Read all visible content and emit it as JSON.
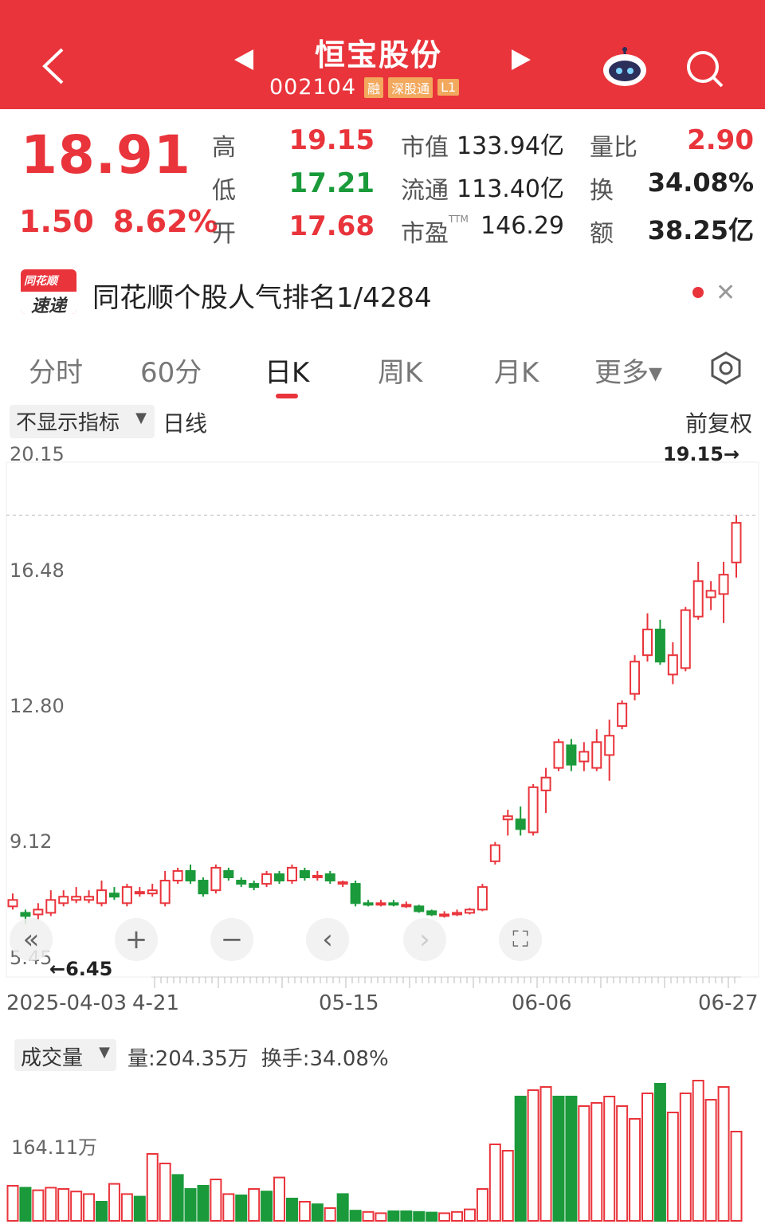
{
  "header": {
    "stock_name": "恒宝股份",
    "stock_code": "002104",
    "badges": [
      "融",
      "深股通",
      "L1"
    ],
    "back_icon": "chevron-left-icon",
    "prev_icon": "triangle-left-icon",
    "next_icon": "triangle-right-icon",
    "robot_icon": "robot-assistant-icon",
    "search_icon": "search-icon"
  },
  "quote": {
    "price": "18.91",
    "change": "1.50",
    "change_pct": "8.62%",
    "high_label": "高",
    "high": "19.15",
    "low_label": "低",
    "low": "17.21",
    "open_label": "开",
    "open": "17.68",
    "mktcap_label": "市值",
    "mktcap": "133.94亿",
    "float_label": "流通",
    "float": "113.40亿",
    "pe_label": "市盈",
    "pe_sup": "TTM",
    "pe": "146.29",
    "vratio_label": "量比",
    "vratio": "2.90",
    "turnover_label": "换",
    "turnover": "34.08%",
    "amount_label": "额",
    "amount": "38.25亿"
  },
  "ranking": {
    "logo_top": "同花顺",
    "logo_bottom": "速递",
    "text": "同花顺个股人气排名1/4284"
  },
  "tabs": [
    {
      "label": "分时"
    },
    {
      "label": "60分"
    },
    {
      "label": "日K"
    },
    {
      "label": "周K"
    },
    {
      "label": "月K"
    },
    {
      "label": "更多▾"
    }
  ],
  "indicator": {
    "select": "不显示指标",
    "period": "日线",
    "adjust": "前复权"
  },
  "chart_labels": {
    "low_mark": "←6.45",
    "high_mark": "19.15→",
    "y_ticks": [
      "20.15",
      "16.48",
      "12.80",
      "9.12",
      "5.45"
    ],
    "x_ticks": [
      "2025-04-03",
      "4-21",
      "05-15",
      "06-06",
      "06-27"
    ]
  },
  "toolbar": {
    "first": "«",
    "zoom_in": "+",
    "zoom_out": "−",
    "prev": "‹",
    "next": "›",
    "fullscreen": "⛶"
  },
  "volume": {
    "select": "成交量",
    "vol_text": "量:204.35万",
    "turnover_text": "换手:34.08%",
    "y_label": "164.11万"
  },
  "colors": {
    "up": "#e9343b",
    "down": "#1a9a3a",
    "header_bg": "#e9343b"
  },
  "chart_data": {
    "type": "candlestick",
    "ylim": [
      5.45,
      20.15
    ],
    "y_ticks": [
      20.15,
      16.48,
      12.8,
      9.12,
      5.45
    ],
    "candles": [
      {
        "o": 7.0,
        "c": 7.2,
        "h": 7.4,
        "l": 6.9
      },
      {
        "o": 6.8,
        "c": 6.7,
        "h": 6.9,
        "l": 6.45
      },
      {
        "o": 6.75,
        "c": 6.9,
        "h": 7.1,
        "l": 6.6
      },
      {
        "o": 6.8,
        "c": 7.2,
        "h": 7.5,
        "l": 6.7
      },
      {
        "o": 7.1,
        "c": 7.3,
        "h": 7.5,
        "l": 7.0
      },
      {
        "o": 7.2,
        "c": 7.3,
        "h": 7.6,
        "l": 7.1
      },
      {
        "o": 7.2,
        "c": 7.3,
        "h": 7.5,
        "l": 7.1
      },
      {
        "o": 7.1,
        "c": 7.5,
        "h": 7.8,
        "l": 7.0
      },
      {
        "o": 7.4,
        "c": 7.3,
        "h": 7.6,
        "l": 7.2
      },
      {
        "o": 7.1,
        "c": 7.6,
        "h": 7.7,
        "l": 7.0
      },
      {
        "o": 7.4,
        "c": 7.45,
        "h": 7.6,
        "l": 7.3
      },
      {
        "o": 7.4,
        "c": 7.5,
        "h": 7.7,
        "l": 7.3
      },
      {
        "o": 7.1,
        "c": 7.8,
        "h": 8.1,
        "l": 7.0
      },
      {
        "o": 7.8,
        "c": 8.1,
        "h": 8.2,
        "l": 7.7
      },
      {
        "o": 8.1,
        "c": 7.8,
        "h": 8.3,
        "l": 7.7
      },
      {
        "o": 7.8,
        "c": 7.4,
        "h": 7.9,
        "l": 7.3
      },
      {
        "o": 7.5,
        "c": 8.2,
        "h": 8.3,
        "l": 7.4
      },
      {
        "o": 8.1,
        "c": 7.9,
        "h": 8.2,
        "l": 7.8
      },
      {
        "o": 7.8,
        "c": 7.7,
        "h": 7.9,
        "l": 7.6
      },
      {
        "o": 7.7,
        "c": 7.6,
        "h": 7.8,
        "l": 7.5
      },
      {
        "o": 7.7,
        "c": 8.0,
        "h": 8.1,
        "l": 7.6
      },
      {
        "o": 8.0,
        "c": 7.8,
        "h": 8.1,
        "l": 7.7
      },
      {
        "o": 7.8,
        "c": 8.2,
        "h": 8.3,
        "l": 7.7
      },
      {
        "o": 8.1,
        "c": 7.9,
        "h": 8.2,
        "l": 7.8
      },
      {
        "o": 7.9,
        "c": 7.95,
        "h": 8.1,
        "l": 7.8
      },
      {
        "o": 8.0,
        "c": 7.8,
        "h": 8.1,
        "l": 7.7
      },
      {
        "o": 7.7,
        "c": 7.75,
        "h": 7.8,
        "l": 7.6
      },
      {
        "o": 7.7,
        "c": 7.1,
        "h": 7.8,
        "l": 7.0
      },
      {
        "o": 7.1,
        "c": 7.05,
        "h": 7.2,
        "l": 7.0
      },
      {
        "o": 7.05,
        "c": 7.1,
        "h": 7.2,
        "l": 7.0
      },
      {
        "o": 7.1,
        "c": 7.05,
        "h": 7.2,
        "l": 7.0
      },
      {
        "o": 7.0,
        "c": 7.05,
        "h": 7.15,
        "l": 6.95
      },
      {
        "o": 7.0,
        "c": 6.85,
        "h": 7.05,
        "l": 6.8
      },
      {
        "o": 6.85,
        "c": 6.75,
        "h": 6.9,
        "l": 6.7
      },
      {
        "o": 6.7,
        "c": 6.75,
        "h": 6.85,
        "l": 6.65
      },
      {
        "o": 6.75,
        "c": 6.8,
        "h": 6.9,
        "l": 6.7
      },
      {
        "o": 6.8,
        "c": 6.9,
        "h": 6.95,
        "l": 6.75
      },
      {
        "o": 6.9,
        "c": 7.6,
        "h": 7.7,
        "l": 6.85
      },
      {
        "o": 8.4,
        "c": 8.9,
        "h": 9.0,
        "l": 8.3
      },
      {
        "o": 9.7,
        "c": 9.8,
        "h": 10.0,
        "l": 9.2
      },
      {
        "o": 9.7,
        "c": 9.4,
        "h": 10.1,
        "l": 9.2
      },
      {
        "o": 9.3,
        "c": 10.7,
        "h": 10.8,
        "l": 9.2
      },
      {
        "o": 10.6,
        "c": 11.0,
        "h": 11.3,
        "l": 9.9
      },
      {
        "o": 11.3,
        "c": 12.1,
        "h": 12.2,
        "l": 11.2
      },
      {
        "o": 12.0,
        "c": 11.4,
        "h": 12.2,
        "l": 11.2
      },
      {
        "o": 11.5,
        "c": 11.8,
        "h": 12.1,
        "l": 11.2
      },
      {
        "o": 11.3,
        "c": 12.1,
        "h": 12.5,
        "l": 11.2
      },
      {
        "o": 11.7,
        "c": 12.3,
        "h": 12.8,
        "l": 10.9
      },
      {
        "o": 12.6,
        "c": 13.3,
        "h": 13.4,
        "l": 12.5
      },
      {
        "o": 13.6,
        "c": 14.6,
        "h": 14.8,
        "l": 13.4
      },
      {
        "o": 14.8,
        "c": 15.6,
        "h": 16.1,
        "l": 14.6
      },
      {
        "o": 15.6,
        "c": 14.6,
        "h": 15.9,
        "l": 14.5
      },
      {
        "o": 14.2,
        "c": 14.8,
        "h": 15.2,
        "l": 13.9
      },
      {
        "o": 14.4,
        "c": 16.2,
        "h": 16.3,
        "l": 14.3
      },
      {
        "o": 16.0,
        "c": 17.1,
        "h": 17.7,
        "l": 15.9
      },
      {
        "o": 16.6,
        "c": 16.8,
        "h": 17.1,
        "l": 16.2
      },
      {
        "o": 16.7,
        "c": 17.3,
        "h": 17.7,
        "l": 15.8
      },
      {
        "o": 17.68,
        "c": 18.91,
        "h": 19.15,
        "l": 17.21
      }
    ],
    "volume_level_label": "164.11万",
    "volumes": [
      {
        "v": 0.55,
        "up": true
      },
      {
        "v": 0.52,
        "up": false
      },
      {
        "v": 0.48,
        "up": true
      },
      {
        "v": 0.52,
        "up": true
      },
      {
        "v": 0.5,
        "up": true
      },
      {
        "v": 0.46,
        "up": true
      },
      {
        "v": 0.42,
        "up": true
      },
      {
        "v": 0.3,
        "up": false
      },
      {
        "v": 0.58,
        "up": true
      },
      {
        "v": 0.42,
        "up": true
      },
      {
        "v": 0.38,
        "up": false
      },
      {
        "v": 1.05,
        "up": true
      },
      {
        "v": 0.9,
        "up": true
      },
      {
        "v": 0.72,
        "up": false
      },
      {
        "v": 0.5,
        "up": false
      },
      {
        "v": 0.55,
        "up": false
      },
      {
        "v": 0.65,
        "up": true
      },
      {
        "v": 0.42,
        "up": true
      },
      {
        "v": 0.4,
        "up": false
      },
      {
        "v": 0.5,
        "up": true
      },
      {
        "v": 0.46,
        "up": false
      },
      {
        "v": 0.68,
        "up": true
      },
      {
        "v": 0.35,
        "up": false
      },
      {
        "v": 0.3,
        "up": true
      },
      {
        "v": 0.26,
        "up": false
      },
      {
        "v": 0.2,
        "up": true
      },
      {
        "v": 0.42,
        "up": false
      },
      {
        "v": 0.16,
        "up": false
      },
      {
        "v": 0.14,
        "up": true
      },
      {
        "v": 0.12,
        "up": true
      },
      {
        "v": 0.15,
        "up": false
      },
      {
        "v": 0.15,
        "up": false
      },
      {
        "v": 0.14,
        "up": false
      },
      {
        "v": 0.13,
        "up": false
      },
      {
        "v": 0.12,
        "up": true
      },
      {
        "v": 0.14,
        "up": true
      },
      {
        "v": 0.18,
        "up": true
      },
      {
        "v": 0.5,
        "up": true
      },
      {
        "v": 1.2,
        "up": true
      },
      {
        "v": 1.1,
        "up": true
      },
      {
        "v": 1.95,
        "up": false
      },
      {
        "v": 2.05,
        "up": true
      },
      {
        "v": 2.1,
        "up": true
      },
      {
        "v": 1.95,
        "up": false
      },
      {
        "v": 1.95,
        "up": false
      },
      {
        "v": 1.8,
        "up": true
      },
      {
        "v": 1.85,
        "up": true
      },
      {
        "v": 1.95,
        "up": true
      },
      {
        "v": 1.8,
        "up": true
      },
      {
        "v": 1.6,
        "up": true
      },
      {
        "v": 2.0,
        "up": true
      },
      {
        "v": 2.15,
        "up": false
      },
      {
        "v": 1.7,
        "up": true
      },
      {
        "v": 2.0,
        "up": true
      },
      {
        "v": 2.2,
        "up": true
      },
      {
        "v": 1.9,
        "up": true
      },
      {
        "v": 2.1,
        "up": true
      },
      {
        "v": 1.4,
        "up": true
      }
    ]
  }
}
